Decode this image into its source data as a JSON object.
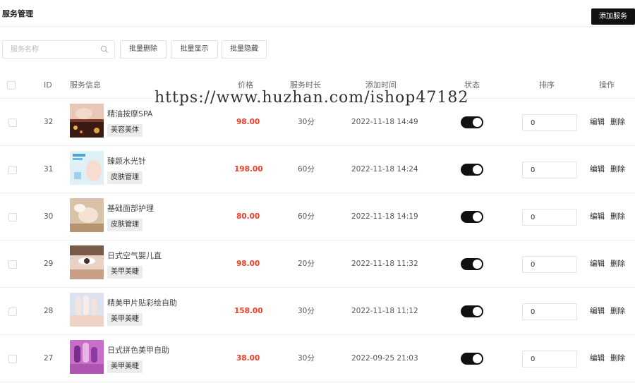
{
  "header": {
    "title": "服务管理",
    "add_button": "添加服务"
  },
  "toolbar": {
    "search_placeholder": "服务名称",
    "batch_delete": "批量删除",
    "batch_show": "批量显示",
    "batch_hide": "批量隐藏"
  },
  "table": {
    "columns": {
      "id": "ID",
      "info": "服务信息",
      "price": "价格",
      "duration": "服务时长",
      "added": "添加时间",
      "status": "状态",
      "sort": "排序",
      "actions": "操作"
    },
    "rows": [
      {
        "id": "32",
        "name": "精油按摩SPA",
        "tag": "美容美体",
        "price": "98.00",
        "duration": "30分",
        "added": "2022-11-18 14:49",
        "status_on": true,
        "sort": "0",
        "edit": "编辑",
        "delete": "删除"
      },
      {
        "id": "31",
        "name": "臻颜水光针",
        "tag": "皮肤管理",
        "price": "198.00",
        "duration": "60分",
        "added": "2022-11-18 14:24",
        "status_on": true,
        "sort": "0",
        "edit": "编辑",
        "delete": "删除"
      },
      {
        "id": "30",
        "name": "基础面部护理",
        "tag": "皮肤管理",
        "price": "80.00",
        "duration": "60分",
        "added": "2022-11-18 14:19",
        "status_on": true,
        "sort": "0",
        "edit": "编辑",
        "delete": "删除"
      },
      {
        "id": "29",
        "name": "日式空气婴儿直",
        "tag": "美甲美睫",
        "price": "98.00",
        "duration": "20分",
        "added": "2022-11-18 11:32",
        "status_on": true,
        "sort": "0",
        "edit": "编辑",
        "delete": "删除"
      },
      {
        "id": "28",
        "name": "精美甲片贴彩绘自助",
        "tag": "美甲美睫",
        "price": "158.00",
        "duration": "30分",
        "added": "2022-11-18 11:12",
        "status_on": true,
        "sort": "0",
        "edit": "编辑",
        "delete": "删除"
      },
      {
        "id": "27",
        "name": "日式拼色美甲自助",
        "tag": "美甲美睫",
        "price": "38.00",
        "duration": "30分",
        "added": "2022-09-25 21:03",
        "status_on": true,
        "sort": "0",
        "edit": "编辑",
        "delete": "删除"
      }
    ]
  },
  "watermark": "https://www.huzhan.com/ishop47182",
  "colors": {
    "price": "#f53b23",
    "primary_button": "#111111",
    "toggle_on": "#111111"
  }
}
